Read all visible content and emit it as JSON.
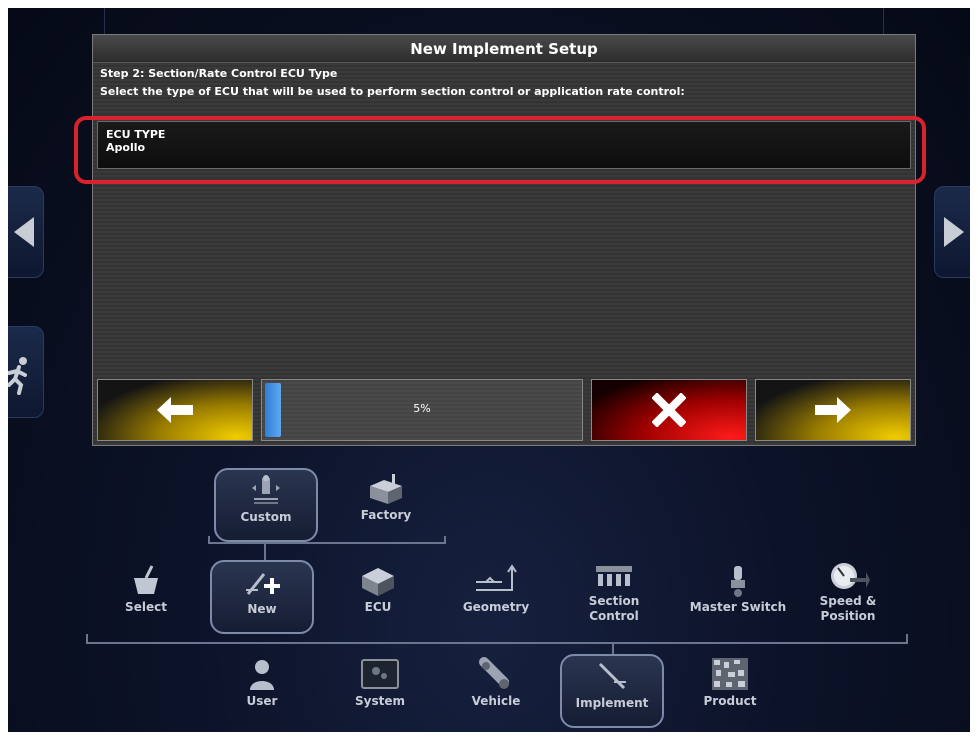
{
  "dialog": {
    "title": "New Implement Setup",
    "step": "Step 2: Section/Rate Control ECU Type",
    "instruction": "Select the type of ECU that will be used to perform section control or application rate control:",
    "ecu_field": {
      "label": "ECU TYPE",
      "value": "Apollo"
    },
    "progress": {
      "label": "5%",
      "value_percent": 5
    },
    "buttons": {
      "back": "back-arrow-icon",
      "cancel": "cancel-x-icon",
      "next": "next-arrow-icon"
    },
    "colors": {
      "highlight": "#d9222c",
      "progress": "#3a8ae0",
      "confirm": "#e8c400",
      "cancel": "#e00000"
    }
  },
  "menu": {
    "level3": [
      {
        "label": "Custom",
        "icon": "custom-icon",
        "selected": true
      },
      {
        "label": "Factory",
        "icon": "factory-icon",
        "selected": false
      }
    ],
    "level2": [
      {
        "label": "Select",
        "icon": "select-basket-icon",
        "selected": false
      },
      {
        "label": "New",
        "icon": "new-implement-icon",
        "selected": true
      },
      {
        "label": "ECU",
        "icon": "ecu-icon",
        "selected": false
      },
      {
        "label": "Geometry",
        "icon": "geometry-icon",
        "selected": false
      },
      {
        "label1": "Section",
        "label2": "Control",
        "icon": "section-control-icon",
        "selected": false
      },
      {
        "label": "Master Switch",
        "icon": "master-switch-icon",
        "selected": false
      },
      {
        "label1": "Speed &",
        "label2": "Position",
        "icon": "speed-gauge-icon",
        "selected": false
      }
    ],
    "level1": [
      {
        "label": "User",
        "icon": "user-icon",
        "selected": false
      },
      {
        "label": "System",
        "icon": "system-icon",
        "selected": false
      },
      {
        "label": "Vehicle",
        "icon": "vehicle-icon",
        "selected": false
      },
      {
        "label": "Implement",
        "icon": "implement-icon",
        "selected": true
      },
      {
        "label": "Product",
        "icon": "product-icon",
        "selected": false
      }
    ]
  }
}
